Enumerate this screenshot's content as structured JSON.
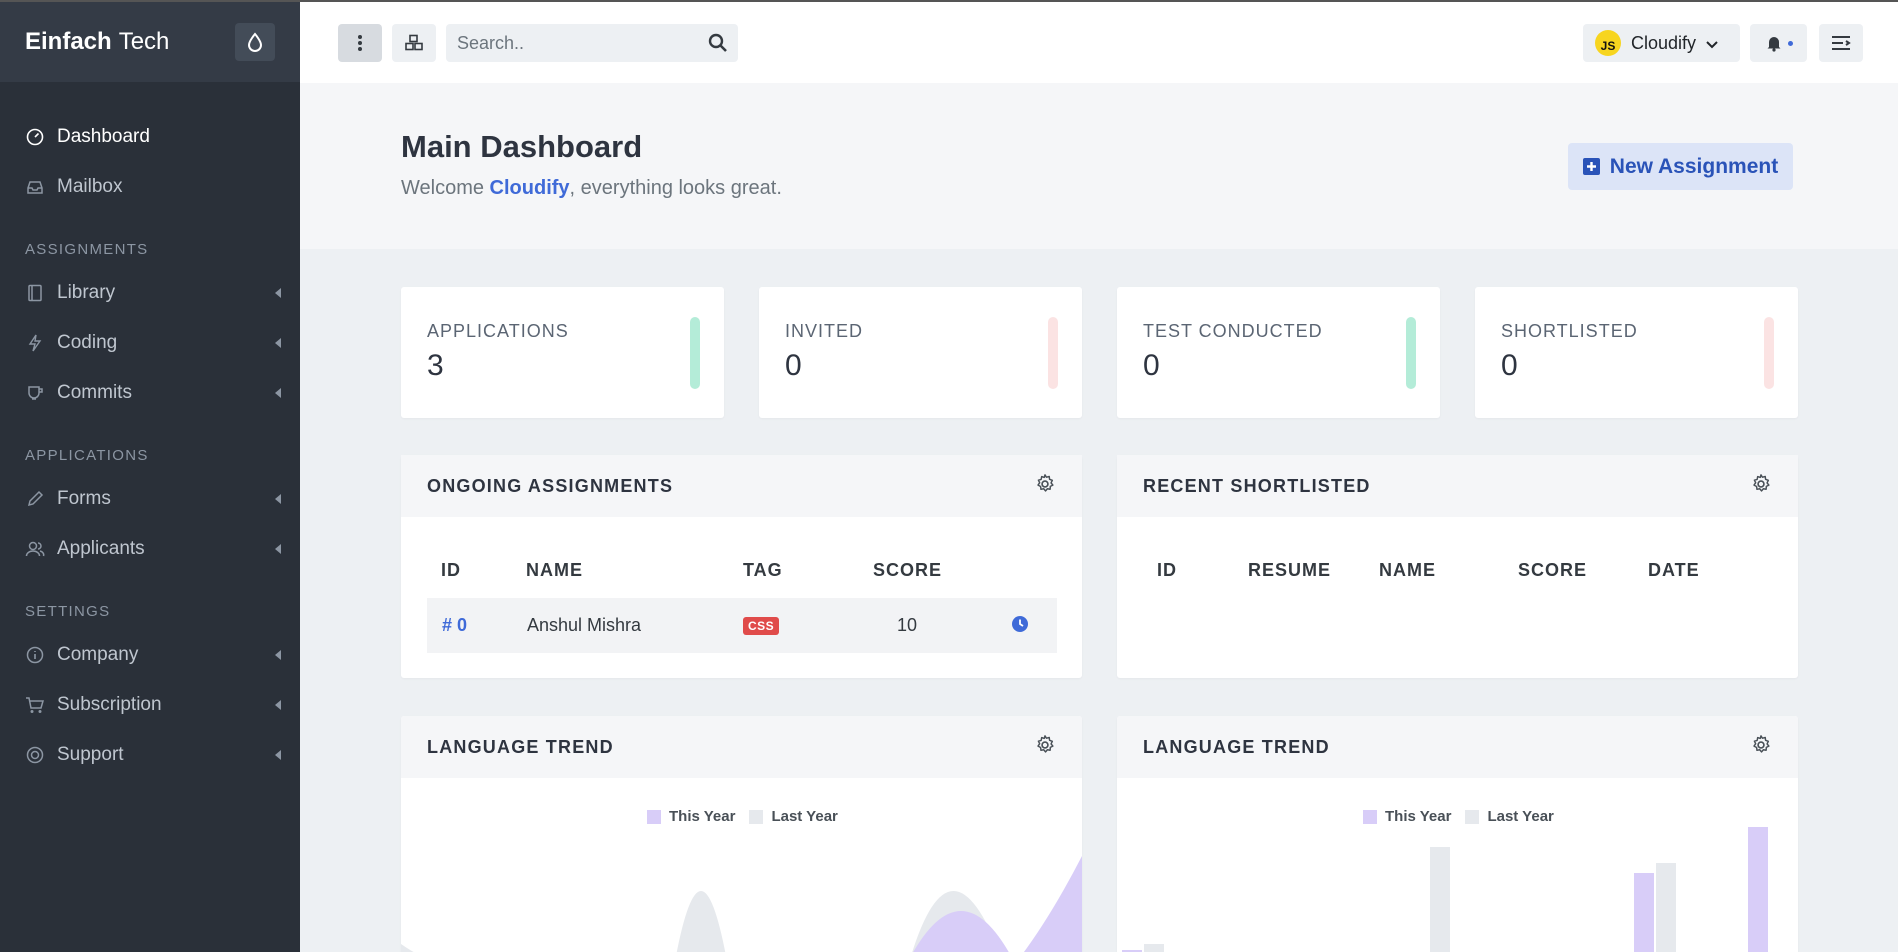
{
  "brand": {
    "bold": "Einfach",
    "light": "Tech"
  },
  "sidebar": {
    "items": [
      {
        "label": "Dashboard"
      },
      {
        "label": "Mailbox"
      }
    ],
    "sections": [
      {
        "heading": "ASSIGNMENTS",
        "items": [
          {
            "label": "Library"
          },
          {
            "label": "Coding"
          },
          {
            "label": "Commits"
          }
        ]
      },
      {
        "heading": "APPLICATIONS",
        "items": [
          {
            "label": "Forms"
          },
          {
            "label": "Applicants"
          }
        ]
      },
      {
        "heading": "SETTINGS",
        "items": [
          {
            "label": "Company"
          },
          {
            "label": "Subscription"
          },
          {
            "label": "Support"
          }
        ]
      }
    ]
  },
  "header": {
    "search_placeholder": "Search..",
    "user": {
      "initials": "JS",
      "name": "Cloudify"
    }
  },
  "hero": {
    "title": "Main Dashboard",
    "welcome_prefix": "Welcome ",
    "welcome_name": "Cloudify",
    "welcome_suffix": ", everything looks great.",
    "new_button": "New Assignment"
  },
  "stats": [
    {
      "label": "APPLICATIONS",
      "value": "3",
      "color": "#b4ecd8"
    },
    {
      "label": "INVITED",
      "value": "0",
      "color": "#fbe3e3"
    },
    {
      "label": "TEST CONDUCTED",
      "value": "0",
      "color": "#b4ecd8"
    },
    {
      "label": "SHORTLISTED",
      "value": "0",
      "color": "#fbe3e3"
    }
  ],
  "ongoing": {
    "title": "ONGOING ASSIGNMENTS",
    "columns": [
      "ID",
      "NAME",
      "TAG",
      "SCORE"
    ],
    "rows": [
      {
        "id": "# 0",
        "name": "Anshul Mishra",
        "tag": "CSS",
        "score": "10"
      }
    ]
  },
  "shortlisted": {
    "title": "RECENT SHORTLISTED",
    "columns": [
      "ID",
      "RESUME",
      "NAME",
      "SCORE",
      "DATE"
    ]
  },
  "trend_left": {
    "title": "LANGUAGE TREND",
    "legend": [
      "This Year",
      "Last Year"
    ]
  },
  "trend_right": {
    "title": "LANGUAGE TREND",
    "legend": [
      "This Year",
      "Last Year"
    ]
  },
  "colors": {
    "accent": "#3f6ad8",
    "sidebar": "#2a3039",
    "this_year": "#d8cdf8",
    "last_year": "#e6e9ed"
  }
}
